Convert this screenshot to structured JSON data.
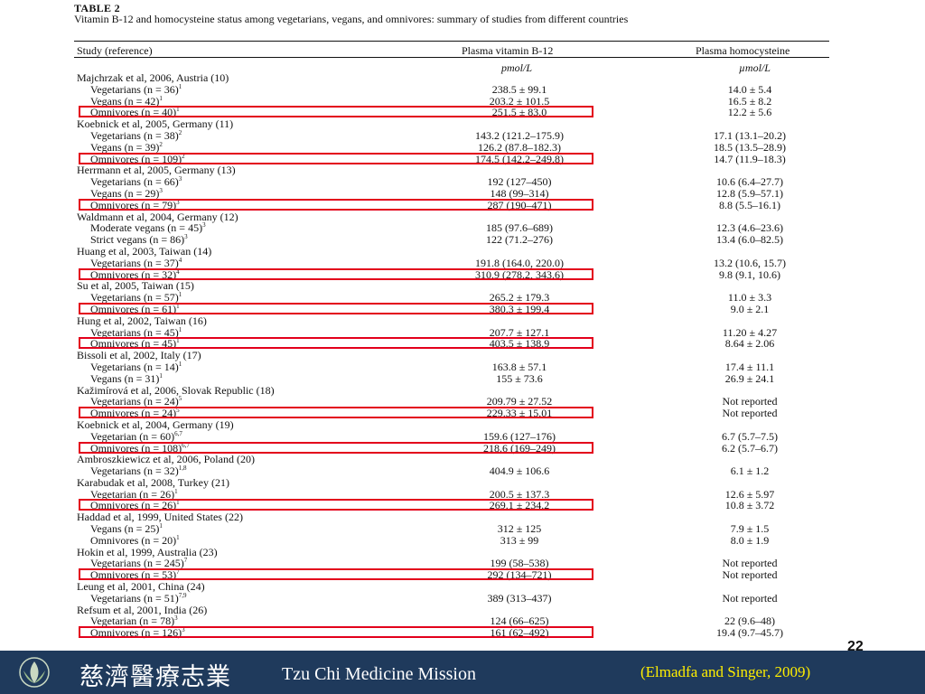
{
  "table": {
    "title": "TABLE 2",
    "caption": "Vitamin B-12 and homocysteine status among vegetarians, vegans, and omnivores: summary of studies from different countries",
    "headers": {
      "study": "Study (reference)",
      "b12": "Plasma vitamin B-12",
      "hcy": "Plasma homocysteine"
    },
    "units": {
      "b12": "pmol/L",
      "hcy": "µmol/L"
    },
    "rows": [
      {
        "study": "Majchrzak et al, 2006, Austria (10)",
        "b12": "",
        "hcy": "",
        "sup": "",
        "indent": false,
        "hl": false
      },
      {
        "study": "Vegetarians (n = 36)",
        "sup": "1",
        "b12": "238.5 ± 99.1",
        "hcy": "14.0 ± 5.4",
        "indent": true,
        "hl": false
      },
      {
        "study": "Vegans (n = 42)",
        "sup": "1",
        "b12": "203.2 ± 101.5",
        "hcy": "16.5 ± 8.2",
        "indent": true,
        "hl": false
      },
      {
        "study": "Omnivores (n = 40)",
        "sup": "1",
        "b12": "251.5 ± 83.0",
        "hcy": "12.2 ± 5.6",
        "indent": true,
        "hl": true
      },
      {
        "study": "Koebnick et al, 2005, Germany (11)",
        "b12": "",
        "hcy": "",
        "sup": "",
        "indent": false,
        "hl": false
      },
      {
        "study": "Vegetarians (n = 38)",
        "sup": "2",
        "b12": "143.2 (121.2–175.9)",
        "hcy": "17.1 (13.1–20.2)",
        "indent": true,
        "hl": false
      },
      {
        "study": "Vegans (n = 39)",
        "sup": "2",
        "b12": "126.2 (87.8–182.3)",
        "hcy": "18.5 (13.5–28.9)",
        "indent": true,
        "hl": false
      },
      {
        "study": "Omnivores (n = 109)",
        "sup": "2",
        "b12": "174.5 (142.2–249.8)",
        "hcy": "14.7 (11.9–18.3)",
        "indent": true,
        "hl": true
      },
      {
        "study": "Herrmann et al, 2005, Germany (13)",
        "b12": "",
        "hcy": "",
        "sup": "",
        "indent": false,
        "hl": false
      },
      {
        "study": "Vegetarians (n = 66)",
        "sup": "3",
        "b12": "192 (127–450)",
        "hcy": "10.6 (6.4–27.7)",
        "indent": true,
        "hl": false
      },
      {
        "study": "Vegans (n = 29)",
        "sup": "3",
        "b12": "148 (99–314)",
        "hcy": "12.8 (5.9–57.1)",
        "indent": true,
        "hl": false
      },
      {
        "study": "Omnivores (n = 79)",
        "sup": "3",
        "b12": "287 (190–471)",
        "hcy": "8.8 (5.5–16.1)",
        "indent": true,
        "hl": true
      },
      {
        "study": "Waldmann et al, 2004, Germany (12)",
        "b12": "",
        "hcy": "",
        "sup": "",
        "indent": false,
        "hl": false
      },
      {
        "study": "Moderate vegans (n = 45)",
        "sup": "3",
        "b12": "185 (97.6–689)",
        "hcy": "12.3 (4.6–23.6)",
        "indent": true,
        "hl": false
      },
      {
        "study": "Strict vegans (n = 86)",
        "sup": "3",
        "b12": "122 (71.2–276)",
        "hcy": "13.4 (6.0–82.5)",
        "indent": true,
        "hl": false
      },
      {
        "study": "Huang et al, 2003, Taiwan (14)",
        "b12": "",
        "hcy": "",
        "sup": "",
        "indent": false,
        "hl": false
      },
      {
        "study": "Vegetarians (n = 37)",
        "sup": "4",
        "b12": "191.8 (164.0, 220.0)",
        "hcy": "13.2 (10.6, 15.7)",
        "indent": true,
        "hl": false
      },
      {
        "study": "Omnivores (n = 32)",
        "sup": "4",
        "b12": "310.9 (278.2, 343.6)",
        "hcy": "9.8 (9.1, 10.6)",
        "indent": true,
        "hl": true
      },
      {
        "study": "Su et al, 2005, Taiwan (15)",
        "b12": "",
        "hcy": "",
        "sup": "",
        "indent": false,
        "hl": false
      },
      {
        "study": "Vegetarians (n = 57)",
        "sup": "1",
        "b12": "265.2 ± 179.3",
        "hcy": "11.0 ± 3.3",
        "indent": true,
        "hl": false
      },
      {
        "study": "Omnivores (n = 61)",
        "sup": "1",
        "b12": "380.3 ± 199.4",
        "hcy": "9.0 ± 2.1",
        "indent": true,
        "hl": true
      },
      {
        "study": "Hung et al, 2002, Taiwan (16)",
        "b12": "",
        "hcy": "",
        "sup": "",
        "indent": false,
        "hl": false
      },
      {
        "study": "Vegetarians (n = 45)",
        "sup": "1",
        "b12": "207.7 ± 127.1",
        "hcy": "11.20 ± 4.27",
        "indent": true,
        "hl": false
      },
      {
        "study": "Omnivores (n = 45)",
        "sup": "1",
        "b12": "403.5 ± 138.9",
        "hcy": "8.64 ± 2.06",
        "indent": true,
        "hl": true
      },
      {
        "study": "Bissoli et al, 2002, Italy (17)",
        "b12": "",
        "hcy": "",
        "sup": "",
        "indent": false,
        "hl": false
      },
      {
        "study": "Vegetarians (n = 14)",
        "sup": "1",
        "b12": "163.8 ± 57.1",
        "hcy": "17.4 ± 11.1",
        "indent": true,
        "hl": false
      },
      {
        "study": "Vegans (n = 31)",
        "sup": "1",
        "b12": "155 ± 73.6",
        "hcy": "26.9 ± 24.1",
        "indent": true,
        "hl": false
      },
      {
        "study": "Kažimírová et al, 2006, Slovak Republic (18)",
        "b12": "",
        "hcy": "",
        "sup": "",
        "indent": false,
        "hl": false
      },
      {
        "study": "Vegetarians (n = 24)",
        "sup": "5",
        "b12": "209.79 ± 27.52",
        "hcy": "Not reported",
        "indent": true,
        "hl": false
      },
      {
        "study": "Omnivores (n = 24)",
        "sup": "5",
        "b12": "229.33 ± 15.01",
        "hcy": "Not reported",
        "indent": true,
        "hl": true
      },
      {
        "study": "Koebnick et al, 2004, Germany (19)",
        "b12": "",
        "hcy": "",
        "sup": "",
        "indent": false,
        "hl": false
      },
      {
        "study": "Vegetarian (n = 60)",
        "sup": "6,7",
        "b12": "159.6 (127–176)",
        "hcy": "6.7 (5.7–7.5)",
        "indent": true,
        "hl": false
      },
      {
        "study": "Omnivores (n = 108)",
        "sup": "6,7",
        "b12": "218.6 (169–249)",
        "hcy": "6.2 (5.7–6.7)",
        "indent": true,
        "hl": true
      },
      {
        "study": "Ambroszkiewicz et al, 2006, Poland (20)",
        "b12": "",
        "hcy": "",
        "sup": "",
        "indent": false,
        "hl": false
      },
      {
        "study": "Vegetarians (n = 32)",
        "sup": "1,8",
        "b12": "404.9 ± 106.6",
        "hcy": "6.1 ± 1.2",
        "indent": true,
        "hl": false
      },
      {
        "study": "Karabudak et al, 2008, Turkey (21)",
        "b12": "",
        "hcy": "",
        "sup": "",
        "indent": false,
        "hl": false
      },
      {
        "study": "Vegetarian (n = 26)",
        "sup": "1",
        "b12": "200.5 ± 137.3",
        "hcy": "12.6 ± 5.97",
        "indent": true,
        "hl": false
      },
      {
        "study": "Omnivores (n = 26)",
        "sup": "1",
        "b12": "269.1 ± 234.2",
        "hcy": "10.8 ± 3.72",
        "indent": true,
        "hl": true
      },
      {
        "study": "Haddad et al, 1999, United States (22)",
        "b12": "",
        "hcy": "",
        "sup": "",
        "indent": false,
        "hl": false
      },
      {
        "study": "Vegans (n = 25)",
        "sup": "1",
        "b12": "312 ± 125",
        "hcy": "7.9 ± 1.5",
        "indent": true,
        "hl": false
      },
      {
        "study": "Omnivores (n = 20)",
        "sup": "1",
        "b12": "313 ± 99",
        "hcy": "8.0 ± 1.9",
        "indent": true,
        "hl": false
      },
      {
        "study": "Hokin et al, 1999, Australia (23)",
        "b12": "",
        "hcy": "",
        "sup": "",
        "indent": false,
        "hl": false
      },
      {
        "study": "Vegetarians (n = 245)",
        "sup": "7",
        "b12": "199 (58–538)",
        "hcy": "Not reported",
        "indent": true,
        "hl": false
      },
      {
        "study": "Omnivores (n = 53)",
        "sup": "7",
        "b12": "292 (134–721)",
        "hcy": "Not reported",
        "indent": true,
        "hl": true
      },
      {
        "study": "Leung et al, 2001, China (24)",
        "b12": "",
        "hcy": "",
        "sup": "",
        "indent": false,
        "hl": false
      },
      {
        "study": "Vegetarians (n = 51)",
        "sup": "7,9",
        "b12": "389 (313–437)",
        "hcy": "Not reported",
        "indent": true,
        "hl": false
      },
      {
        "study": "Refsum et al, 2001, India (26)",
        "b12": "",
        "hcy": "",
        "sup": "",
        "indent": false,
        "hl": false
      },
      {
        "study": "Vegetarian (n = 78)",
        "sup": "3",
        "b12": "124 (66–625)",
        "hcy": "22 (9.6–48)",
        "indent": true,
        "hl": false
      },
      {
        "study": "Omnivores (n = 126)",
        "sup": "3",
        "b12": "161 (62–492)",
        "hcy": "19.4 (9.7–45.7)",
        "indent": true,
        "hl": true
      }
    ]
  },
  "page_number": "22",
  "footer": {
    "logo_icon": "lotus-logo-icon",
    "cjk_name": "慈濟醫療志業",
    "brand": "Tzu Chi Medicine Mission",
    "citation": "(Elmadfa and Singer, 2009)"
  },
  "colors": {
    "highlight": "#e3001b",
    "footer_bg": "#1f3a5c",
    "citation_text": "#ffee00"
  }
}
